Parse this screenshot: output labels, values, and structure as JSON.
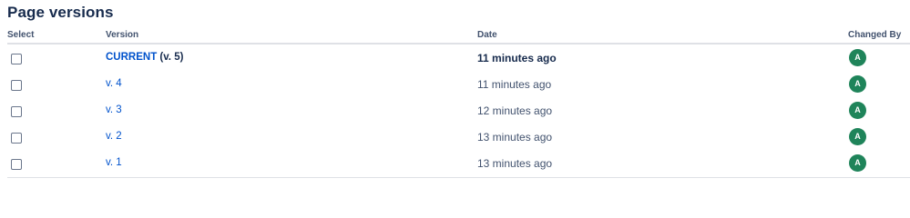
{
  "page": {
    "title": "Page versions"
  },
  "table": {
    "headers": {
      "select": "Select",
      "version": "Version",
      "date": "Date",
      "changed_by": "Changed By"
    },
    "rows": [
      {
        "version_link": "CURRENT",
        "version_suffix": " (v. 5)",
        "date": "11 minutes ago",
        "avatar": "A",
        "current": true
      },
      {
        "version_link": "v. 4",
        "version_suffix": "",
        "date": "11 minutes ago",
        "avatar": "A",
        "current": false
      },
      {
        "version_link": "v. 3",
        "version_suffix": "",
        "date": "12 minutes ago",
        "avatar": "A",
        "current": false
      },
      {
        "version_link": "v. 2",
        "version_suffix": "",
        "date": "13 minutes ago",
        "avatar": "A",
        "current": false
      },
      {
        "version_link": "v. 1",
        "version_suffix": "",
        "date": "13 minutes ago",
        "avatar": "A",
        "current": false
      }
    ]
  },
  "colors": {
    "link": "#0052cc",
    "avatar_bg": "#1f845a",
    "text": "#172b4d"
  }
}
